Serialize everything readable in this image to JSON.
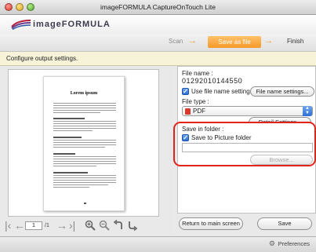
{
  "window": {
    "title": "imageFORMULA CaptureOnTouch Lite"
  },
  "brand": {
    "name": "imageFORMULA"
  },
  "steps": {
    "scan": "Scan",
    "save": "Save as file",
    "finish": "Finish"
  },
  "instruction": "Configure output settings.",
  "preview": {
    "doc_title": "Lorem ipsum",
    "page_current": "1",
    "page_total": "/1"
  },
  "settings": {
    "file_name_label": "File name :",
    "file_name_value": "01292010144550",
    "use_settings_label": "Use file name settings",
    "use_settings_checked": true,
    "file_name_settings_button": "File name settings...",
    "file_type_label": "File type :",
    "file_type_value": "PDF",
    "detail_settings_button": "Detail Settings...",
    "save_in_folder_label": "Save in folder :",
    "save_to_picture_label": "Save to Picture folder",
    "save_to_picture_checked": true,
    "folder_path": "",
    "browse_button": "Browse..."
  },
  "actions": {
    "return_button": "Return to main screen",
    "save_button": "Save"
  },
  "status": {
    "preferences": "Preferences"
  },
  "colors": {
    "accent_orange": "#f59a28",
    "highlight_red": "#e2231a",
    "checkbox_blue": "#2c6fd4"
  },
  "icons": [
    "first-page-icon",
    "prev-page-icon",
    "next-page-icon",
    "last-page-icon",
    "zoom-in-icon",
    "zoom-out-icon",
    "rotate-left-icon",
    "rotate-right-icon",
    "preferences-icon"
  ]
}
